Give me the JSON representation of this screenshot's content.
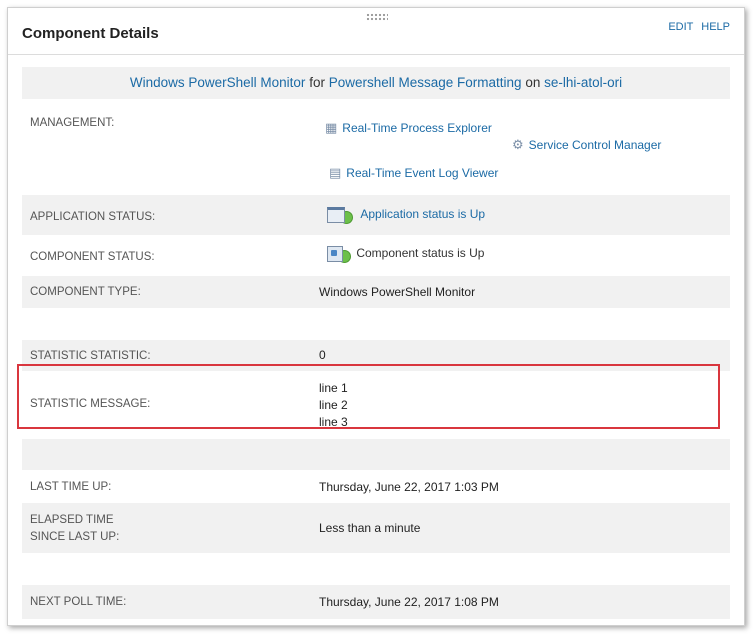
{
  "header": {
    "title": "Component Details",
    "edit_label": "EDIT",
    "help_label": "HELP"
  },
  "summary": {
    "monitor": "Windows PowerShell Monitor",
    "for_word": "for",
    "application": "Powershell Message Formatting",
    "on_word": "on",
    "node": "se-lhi-atol-ori"
  },
  "management": {
    "label": "MANAGEMENT:",
    "process_explorer": "Real-Time Process Explorer",
    "service_control": "Service Control Manager",
    "event_log": "Real-Time Event Log Viewer"
  },
  "application_status": {
    "label": "APPLICATION STATUS:",
    "value": "Application status is Up"
  },
  "component_status": {
    "label": "COMPONENT STATUS:",
    "value": "Component status is Up"
  },
  "component_type": {
    "label": "COMPONENT TYPE:",
    "value": "Windows PowerShell Monitor"
  },
  "statistic": {
    "label": "STATISTIC STATISTIC:",
    "value": "0"
  },
  "statistic_message": {
    "label": "STATISTIC MESSAGE:",
    "lines": [
      "line 1",
      "line 2",
      "line 3"
    ]
  },
  "last_time_up": {
    "label": "LAST TIME UP:",
    "value": "Thursday, June 22, 2017 1:03 PM"
  },
  "elapsed": {
    "label_line1": "ELAPSED TIME",
    "label_line2": "SINCE LAST UP:",
    "value": "Less than a minute"
  },
  "next_poll": {
    "label": "NEXT POLL TIME:",
    "value": "Thursday, June 22, 2017 1:08 PM"
  },
  "colors": {
    "link": "#1b6aa5",
    "status_up": "#6cc04a",
    "highlight": "#d9363e"
  }
}
